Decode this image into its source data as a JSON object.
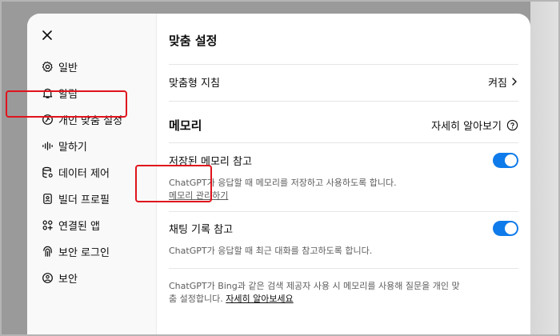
{
  "sidebar": {
    "items": [
      {
        "label": "일반",
        "icon": "gear-icon"
      },
      {
        "label": "알림",
        "icon": "bell-icon"
      },
      {
        "label": "개인 맞춤 설정",
        "icon": "personalization-icon"
      },
      {
        "label": "말하기",
        "icon": "waveform-icon"
      },
      {
        "label": "데이터 제어",
        "icon": "database-icon"
      },
      {
        "label": "빌더 프로필",
        "icon": "id-card-icon"
      },
      {
        "label": "연결된 앱",
        "icon": "apps-grid-icon"
      },
      {
        "label": "보안 로그인",
        "icon": "fingerprint-icon"
      },
      {
        "label": "보안",
        "icon": "shield-user-icon"
      }
    ]
  },
  "main": {
    "title": "맞춤 설정",
    "custom_instructions": {
      "label": "맞춤형 지침",
      "value": "켜짐"
    },
    "memory": {
      "title": "메모리",
      "learn_more": "자세히 알아보기",
      "saved_memory": {
        "label": "저장된 메모리 참고",
        "desc": "ChatGPT가 응답할 때 메모리를 저장하고 사용하도록 합니다.",
        "manage_link": "메모리 관리하기",
        "enabled": true
      },
      "chat_history": {
        "label": "채팅 기록 참고",
        "desc": "ChatGPT가 응답할 때 최근 대화를 참고하도록 합니다.",
        "enabled": true
      },
      "footer": {
        "text_line1": "ChatGPT가 Bing과 같은 검색 제공자 사용 시 메모리를 사용해 질문을 개인 맞",
        "text_line2": "춤 설정합니다.",
        "link": "자세히 알아보세요"
      }
    }
  },
  "colors": {
    "accent": "#0f7bea",
    "highlight": "#e0141c"
  }
}
